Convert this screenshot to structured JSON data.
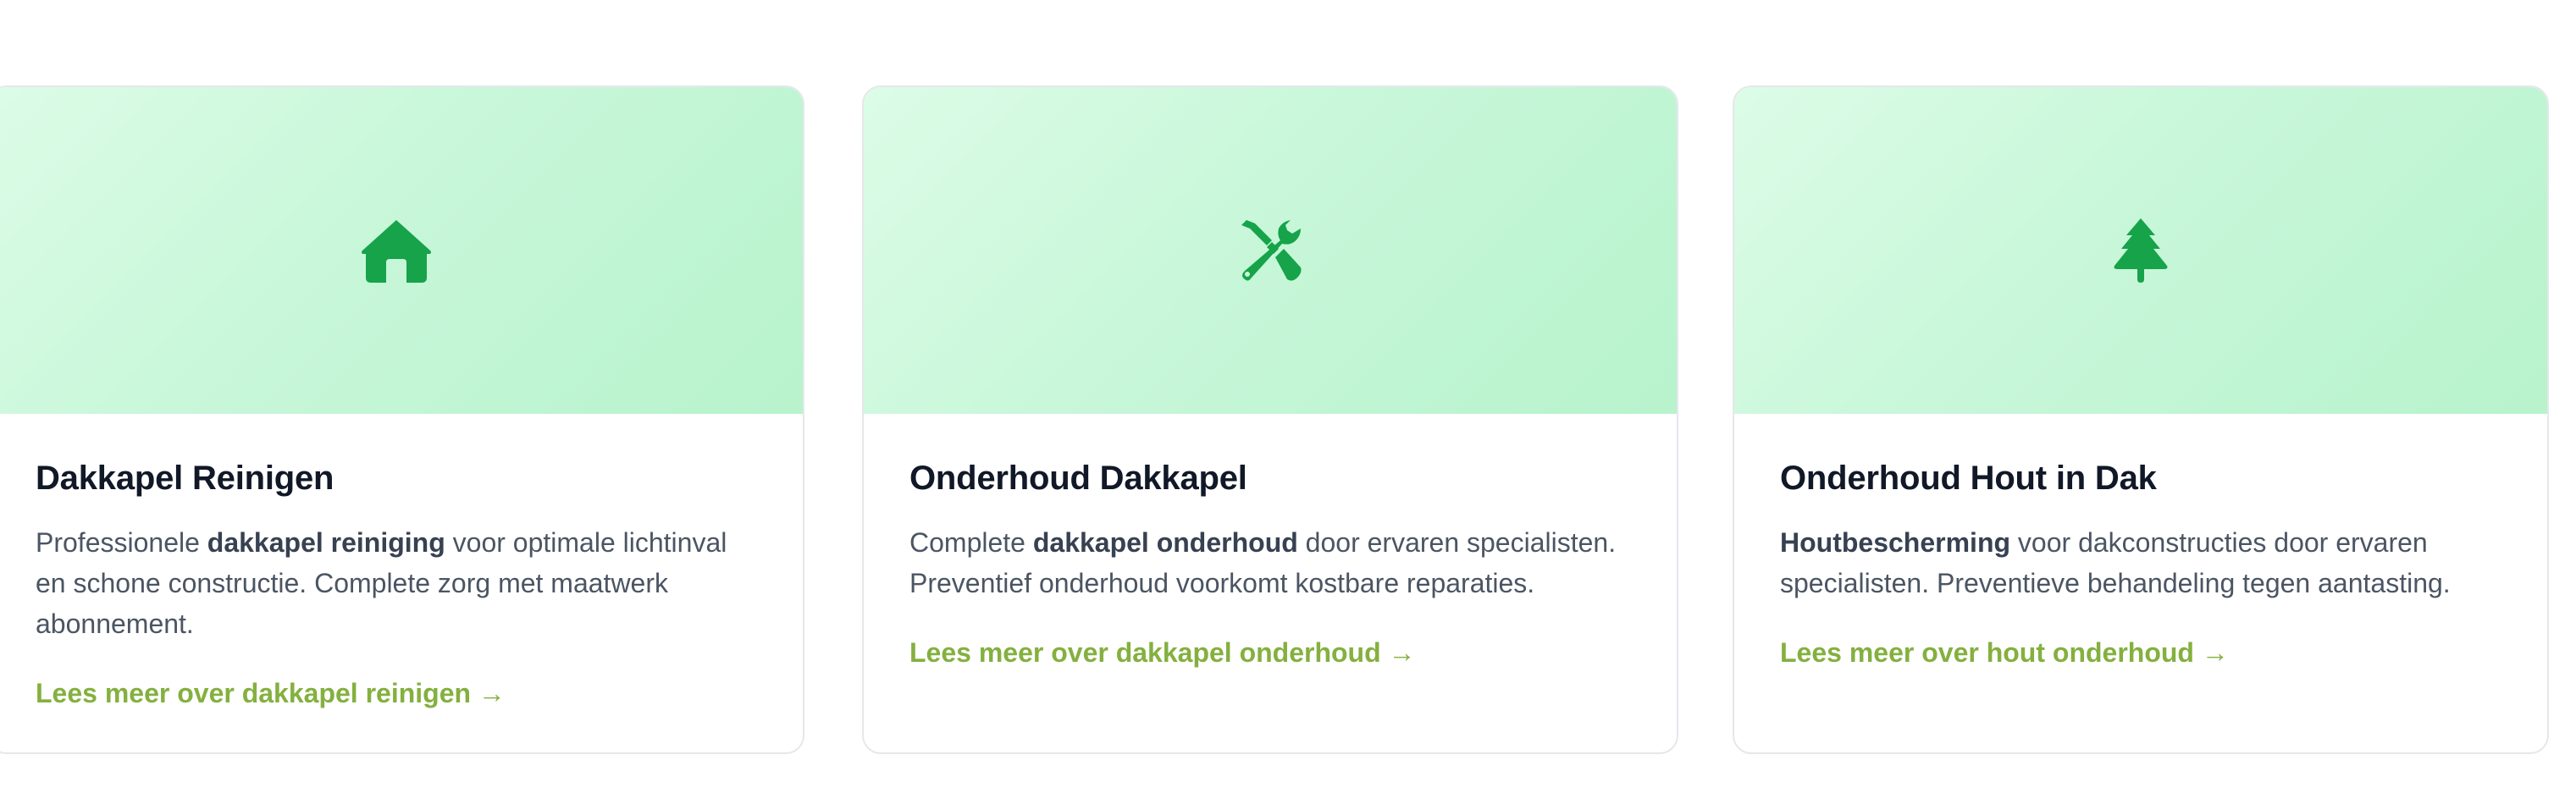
{
  "services": [
    {
      "icon": "home-icon",
      "title": "Dakkapel Reinigen",
      "text_before": "Professionele ",
      "text_bold": "dakkapel reiniging",
      "text_after": " voor optimale lichtinval en schone constructie. Complete zorg met maatwerk abonnement.",
      "link": "Lees meer over dakkapel reinigen →"
    },
    {
      "icon": "tools-icon",
      "title": "Onderhoud Dakkapel",
      "text_before": "Complete ",
      "text_bold": "dakkapel onderhoud",
      "text_after": " door ervaren specialisten. Preventief onderhoud voorkomt kostbare reparaties.",
      "link": "Lees meer over dakkapel onderhoud →"
    },
    {
      "icon": "tree-icon",
      "title": "Onderhoud Hout in Dak",
      "text_before": "",
      "text_bold": "Houtbescherming",
      "text_after": " voor dakconstructies door ervaren specialisten. Preventieve behandeling tegen aantasting.",
      "link": "Lees meer over hout onderhoud →"
    }
  ],
  "colors": {
    "icon": "#16a34a",
    "link": "#84b03f",
    "title": "#111827",
    "text": "#4b5563"
  }
}
